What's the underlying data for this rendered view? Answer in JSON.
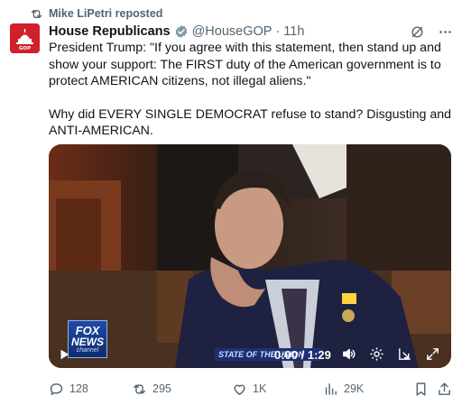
{
  "repost": {
    "text": "Mike LiPetri reposted",
    "icon": "repost-icon"
  },
  "author": {
    "name": "House Republicans",
    "handle": "@HouseGOP",
    "separator": "·",
    "time": "11h",
    "avatar": "gop-capitol-logo",
    "avatar_label": "GOP",
    "verified": true
  },
  "tweet": {
    "paragraphs": [
      "President Trump: \"If you agree with this statement, then stand up and show your support: The FIRST duty of the American government is to protect AMERICAN citizens, not illegal aliens.\"",
      "Why did EVERY SINGLE DEMOCRAT refuse to stand? Disgusting and ANTI-AMERICAN."
    ]
  },
  "video": {
    "time": "0:00 / 1:29",
    "overlay_logo": {
      "line1": "FOX",
      "line2": "NEWS",
      "line3": "channel"
    },
    "ticker": "STATE OF THE UNION",
    "controls": [
      "play-icon",
      "volume-icon",
      "settings-icon",
      "pip-icon",
      "fullscreen-icon"
    ]
  },
  "actions": {
    "replies": "128",
    "reposts": "295",
    "likes": "1K",
    "views": "29K"
  },
  "colors": {
    "text": "#0f1419",
    "secondary": "#536471",
    "verified": "#829aab",
    "avatar_bg": "#d0202b"
  }
}
